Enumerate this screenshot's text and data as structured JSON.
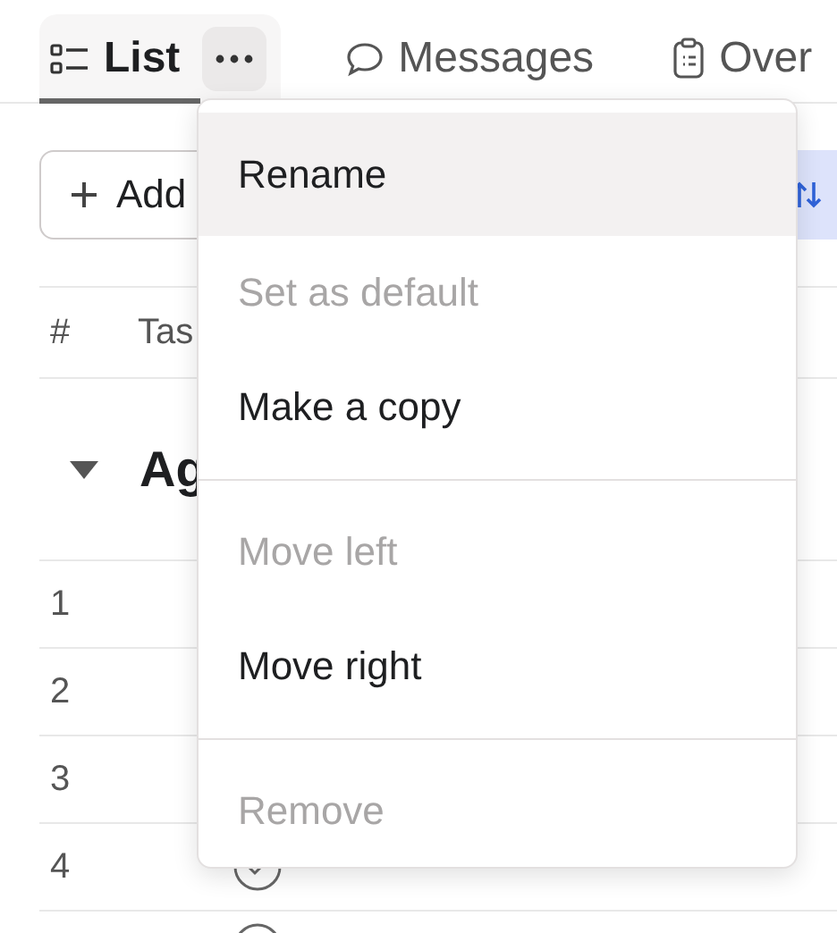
{
  "tabs": [
    {
      "label": "List",
      "kind": "list",
      "selected": true,
      "has_menu": true
    },
    {
      "label": "Messages",
      "kind": "chat",
      "selected": false,
      "has_menu": false
    },
    {
      "label": "Over",
      "kind": "clipboard",
      "selected": false,
      "has_menu": false
    }
  ],
  "toolbar": {
    "add_button": "Add"
  },
  "table": {
    "columns": [
      "#",
      "Tas"
    ],
    "group": {
      "name": "Ag",
      "expanded": true
    },
    "rows": [
      {
        "number": "1",
        "kind": "covered"
      },
      {
        "number": "2",
        "kind": "covered"
      },
      {
        "number": "3",
        "kind": "covered"
      },
      {
        "number": "4",
        "kind": "task"
      }
    ]
  },
  "menu": {
    "sections": [
      [
        {
          "label": "Rename",
          "disabled": false,
          "highlighted": true
        },
        {
          "label": "Set as default",
          "disabled": true,
          "highlighted": false
        },
        {
          "label": "Make a copy",
          "disabled": false,
          "highlighted": false
        }
      ],
      [
        {
          "label": "Move left",
          "disabled": true,
          "highlighted": false
        },
        {
          "label": "Move right",
          "disabled": false,
          "highlighted": false
        }
      ],
      [
        {
          "label": "Remove",
          "disabled": true,
          "highlighted": false
        }
      ]
    ]
  }
}
